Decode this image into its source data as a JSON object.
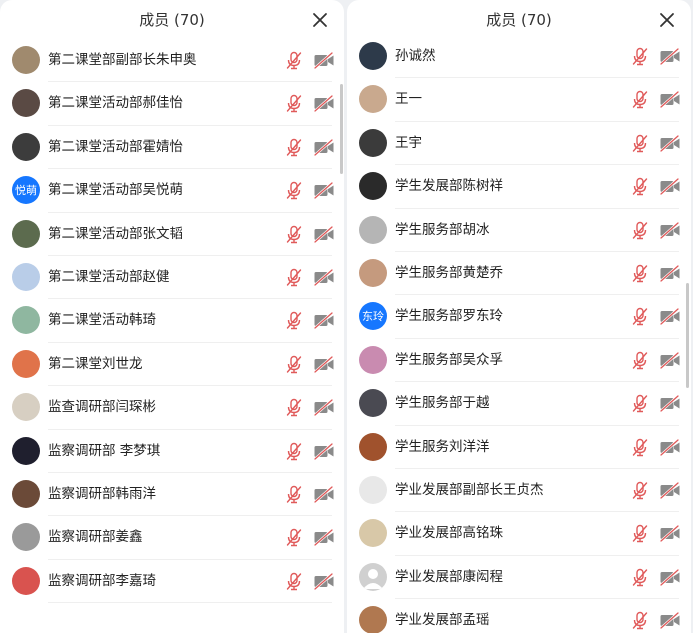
{
  "left_panel": {
    "title": "成员 (70)",
    "members": [
      {
        "name": "第二课堂部副部长朱申奥",
        "avatar_color": "#a08a6e"
      },
      {
        "name": "第二课堂活动部郝佳怡",
        "avatar_color": "#5a4a44"
      },
      {
        "name": "第二课堂活动部霍婧怡",
        "avatar_color": "#3c3c3c"
      },
      {
        "name": "第二课堂活动部吴悦萌",
        "avatar_text": "悦萌",
        "avatar_color": "#1677ff"
      },
      {
        "name": "第二课堂活动部张文韬",
        "avatar_color": "#5c6b4e"
      },
      {
        "name": "第二课堂活动部赵健",
        "avatar_color": "#b9cde8"
      },
      {
        "name": "第二课堂活动韩琦",
        "avatar_color": "#8fb7a0"
      },
      {
        "name": "第二课堂刘世龙",
        "avatar_color": "#e0734a"
      },
      {
        "name": "监查调研部闫琛彬",
        "avatar_color": "#d7cfc2"
      },
      {
        "name": "监察调研部 李梦琪",
        "avatar_color": "#1f1f2e"
      },
      {
        "name": "监察调研部韩雨洋",
        "avatar_color": "#6b4a38"
      },
      {
        "name": "监察调研部姜鑫",
        "avatar_color": "#9a9a9a"
      },
      {
        "name": "监察调研部李嘉琦",
        "avatar_color": "#d9534f"
      }
    ]
  },
  "right_panel": {
    "title": "成员 (70)",
    "members": [
      {
        "name": "孙诚然",
        "avatar_color": "#2d3a4a"
      },
      {
        "name": "王一",
        "avatar_color": "#c9a98e"
      },
      {
        "name": "王宇",
        "avatar_color": "#3b3b3b"
      },
      {
        "name": "学生发展部陈树祥",
        "avatar_color": "#2a2a2a"
      },
      {
        "name": "学生服务部胡冰",
        "avatar_color": "#b5b5b5"
      },
      {
        "name": "学生服务部黄楚乔",
        "avatar_color": "#c59a7e"
      },
      {
        "name": "学生服务部罗东玲",
        "avatar_text": "东玲",
        "avatar_color": "#1677ff"
      },
      {
        "name": "学生服务部吴众孚",
        "avatar_color": "#c98bb0"
      },
      {
        "name": "学生服务部于越",
        "avatar_color": "#4a4a52"
      },
      {
        "name": "学生服务刘洋洋",
        "avatar_color": "#a0522d"
      },
      {
        "name": "学业发展部副部长王贞杰",
        "avatar_color": "#e8e8e8"
      },
      {
        "name": "学业发展部高铭珠",
        "avatar_color": "#d8c8a8"
      },
      {
        "name": "学业发展部康闳程",
        "avatar_color": "#d0d0d0",
        "avatar_placeholder": true
      },
      {
        "name": "学业发展部孟瑶",
        "avatar_color": "#b07850"
      }
    ]
  },
  "icons": {
    "close": "close-icon",
    "mic": "mic-muted-icon",
    "camera": "camera-off-icon"
  },
  "colors": {
    "mute_red": "#e05a5a",
    "icon_gray": "#8a8a8a",
    "badge_blue": "#1677ff"
  }
}
